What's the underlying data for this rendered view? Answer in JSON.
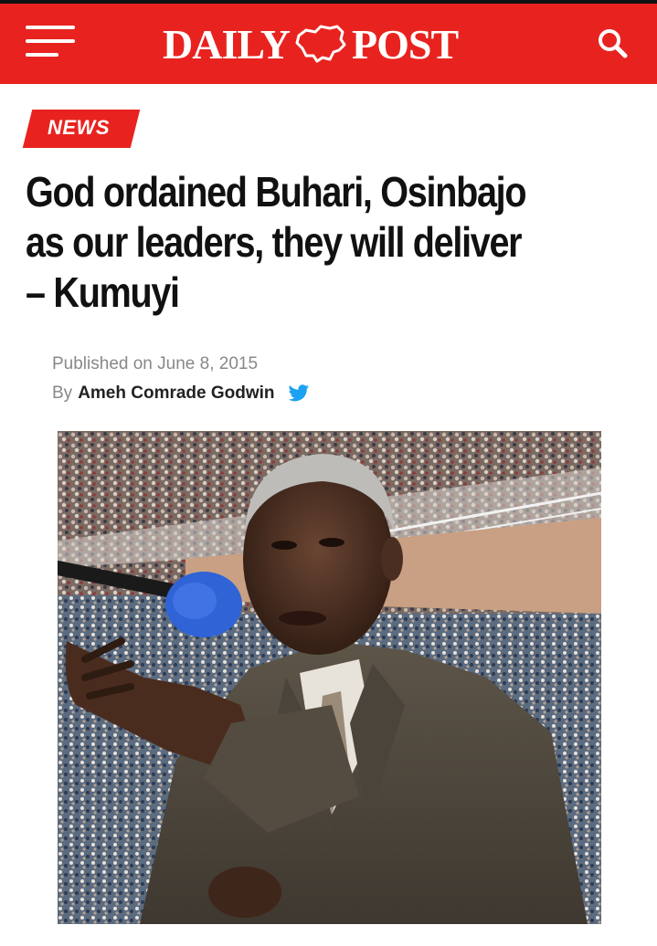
{
  "header": {
    "brand_left": "DAILY",
    "brand_right": "POST",
    "brand_color": "#e8231f"
  },
  "article": {
    "category": "NEWS",
    "headline": "God ordained Buhari, Osinbajo\nas our leaders, they will deliver\n– Kumuyi",
    "published_label": "Published on",
    "published_date": "June 8, 2015",
    "by_label": "By",
    "author": "Ameh Comrade Godwin"
  },
  "icons": {
    "menu": "hamburger-menu-icon",
    "search": "search-icon",
    "share": "twitter-icon",
    "logo_mark": "nigeria-map-icon"
  }
}
